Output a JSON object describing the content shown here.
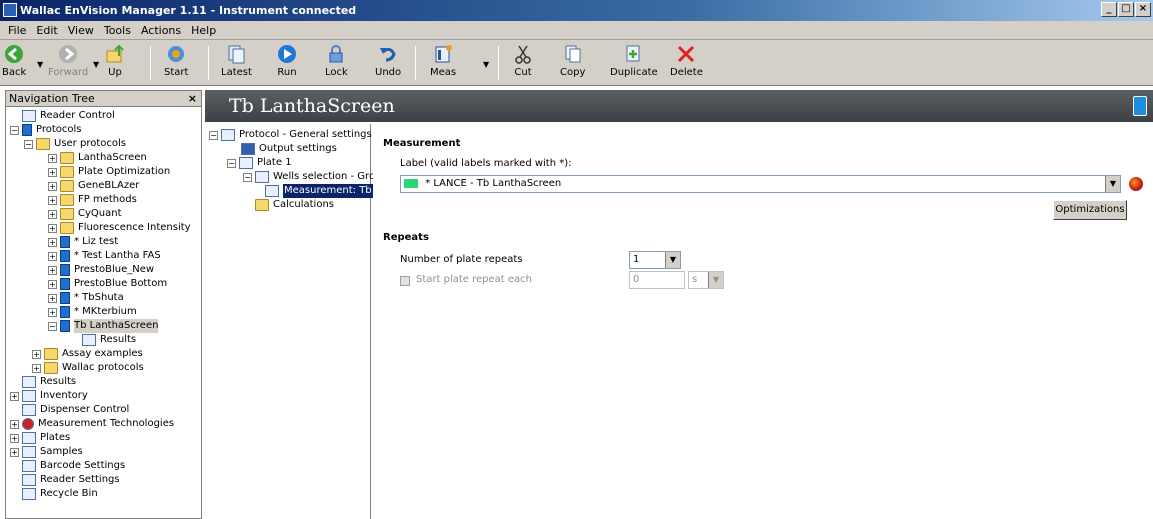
{
  "window": {
    "title": "Wallac EnVision Manager 1.11 - Instrument connected",
    "controls": [
      "_",
      "□",
      "×"
    ]
  },
  "menu": [
    "File",
    "Edit",
    "View",
    "Tools",
    "Actions",
    "Help"
  ],
  "toolbar": {
    "back": "Back",
    "forward": "Forward",
    "up": "Up",
    "start": "Start",
    "latest": "Latest",
    "run": "Run",
    "lock": "Lock",
    "undo": "Undo",
    "meas": "Meas",
    "cut": "Cut",
    "copy": "Copy",
    "duplicate": "Duplicate",
    "delete": "Delete"
  },
  "nav": {
    "title": "Navigation Tree",
    "close": "×",
    "items": [
      "Reader Control",
      "Protocols",
      "User protocols",
      "LanthaScreen",
      "Plate Optimization",
      "GeneBLAzer",
      "FP methods",
      "CyQuant",
      "Fluorescence Intensity",
      "* Liz test",
      "* Test Lantha FAS",
      "PrestoBlue_New",
      "PrestoBlue Bottom",
      "* TbShuta",
      "* MKterbium",
      "Tb LanthaScreen",
      "Results",
      "Assay examples",
      "Wallac protocols",
      "Results",
      "Inventory",
      "Dispenser Control",
      "Measurement Technologies",
      "Plates",
      "Samples",
      "Barcode Settings",
      "Reader Settings",
      "Recycle Bin"
    ]
  },
  "header": {
    "title": "Tb LanthaScreen"
  },
  "protocol_tree": [
    "Protocol - General settings",
    "Output settings",
    "Plate 1",
    "Wells selection - Grou",
    "Measurement: Tb",
    "Calculations"
  ],
  "detail": {
    "measurement_heading": "Measurement",
    "label_caption": "Label (valid labels marked with *):",
    "label_value": "* LANCE - Tb LanthaScreen",
    "optimizations": "Optimizations",
    "repeats_heading": "Repeats",
    "plate_repeats_label": "Number of plate repeats",
    "plate_repeats_value": "1",
    "start_repeat_label": "Start plate repeat each",
    "start_repeat_value": "0",
    "start_repeat_unit": "s"
  },
  "colors": {
    "label_swatch": "#2ed47a",
    "header_bg": "#4a4e52",
    "accent": "#1e6fd0"
  }
}
